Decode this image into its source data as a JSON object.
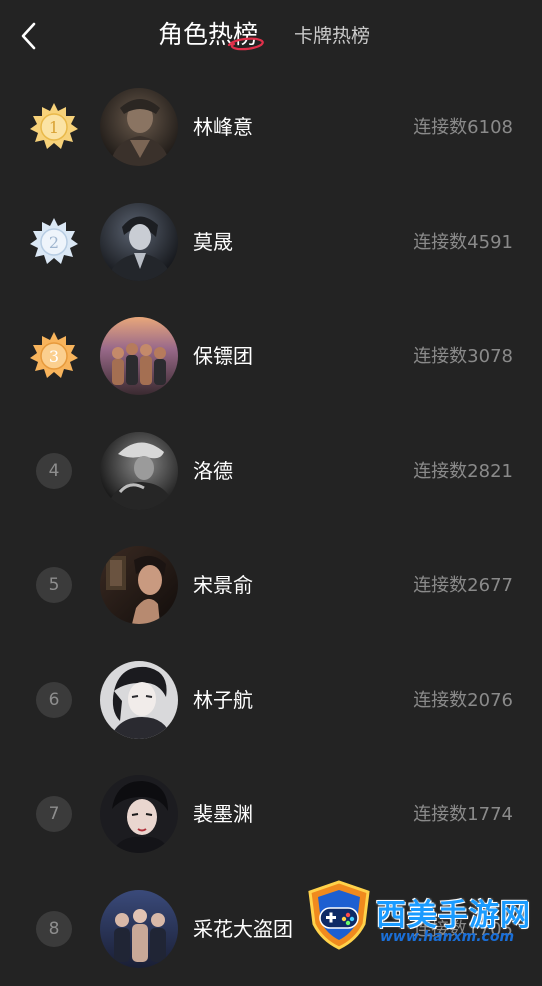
{
  "header": {
    "back_icon": "chevron-left-icon",
    "tab_active_label": "角色热榜",
    "tab_inactive_label": "卡牌热榜",
    "accent_color": "#e0304a"
  },
  "ranking": [
    {
      "rank": "1",
      "name": "林峰意",
      "count": "连接数6108",
      "medal": "gold"
    },
    {
      "rank": "2",
      "name": "莫晟",
      "count": "连接数4591",
      "medal": "silver"
    },
    {
      "rank": "3",
      "name": "保镖团",
      "count": "连接数3078",
      "medal": "bronze"
    },
    {
      "rank": "4",
      "name": "洛德",
      "count": "连接数2821"
    },
    {
      "rank": "5",
      "name": "宋景俞",
      "count": "连接数2677"
    },
    {
      "rank": "6",
      "name": "林子航",
      "count": "连接数2076"
    },
    {
      "rank": "7",
      "name": "裴墨渊",
      "count": "连接数1774"
    },
    {
      "rank": "8",
      "name": "采花大盗团",
      "count": "连接数1705"
    }
  ],
  "medal_colors": {
    "gold": "#f2c14e",
    "silver": "#cfe0f2",
    "bronze": "#f6a84c"
  },
  "watermark": {
    "title": "西美手游网",
    "url": "www.hanxm.com"
  }
}
